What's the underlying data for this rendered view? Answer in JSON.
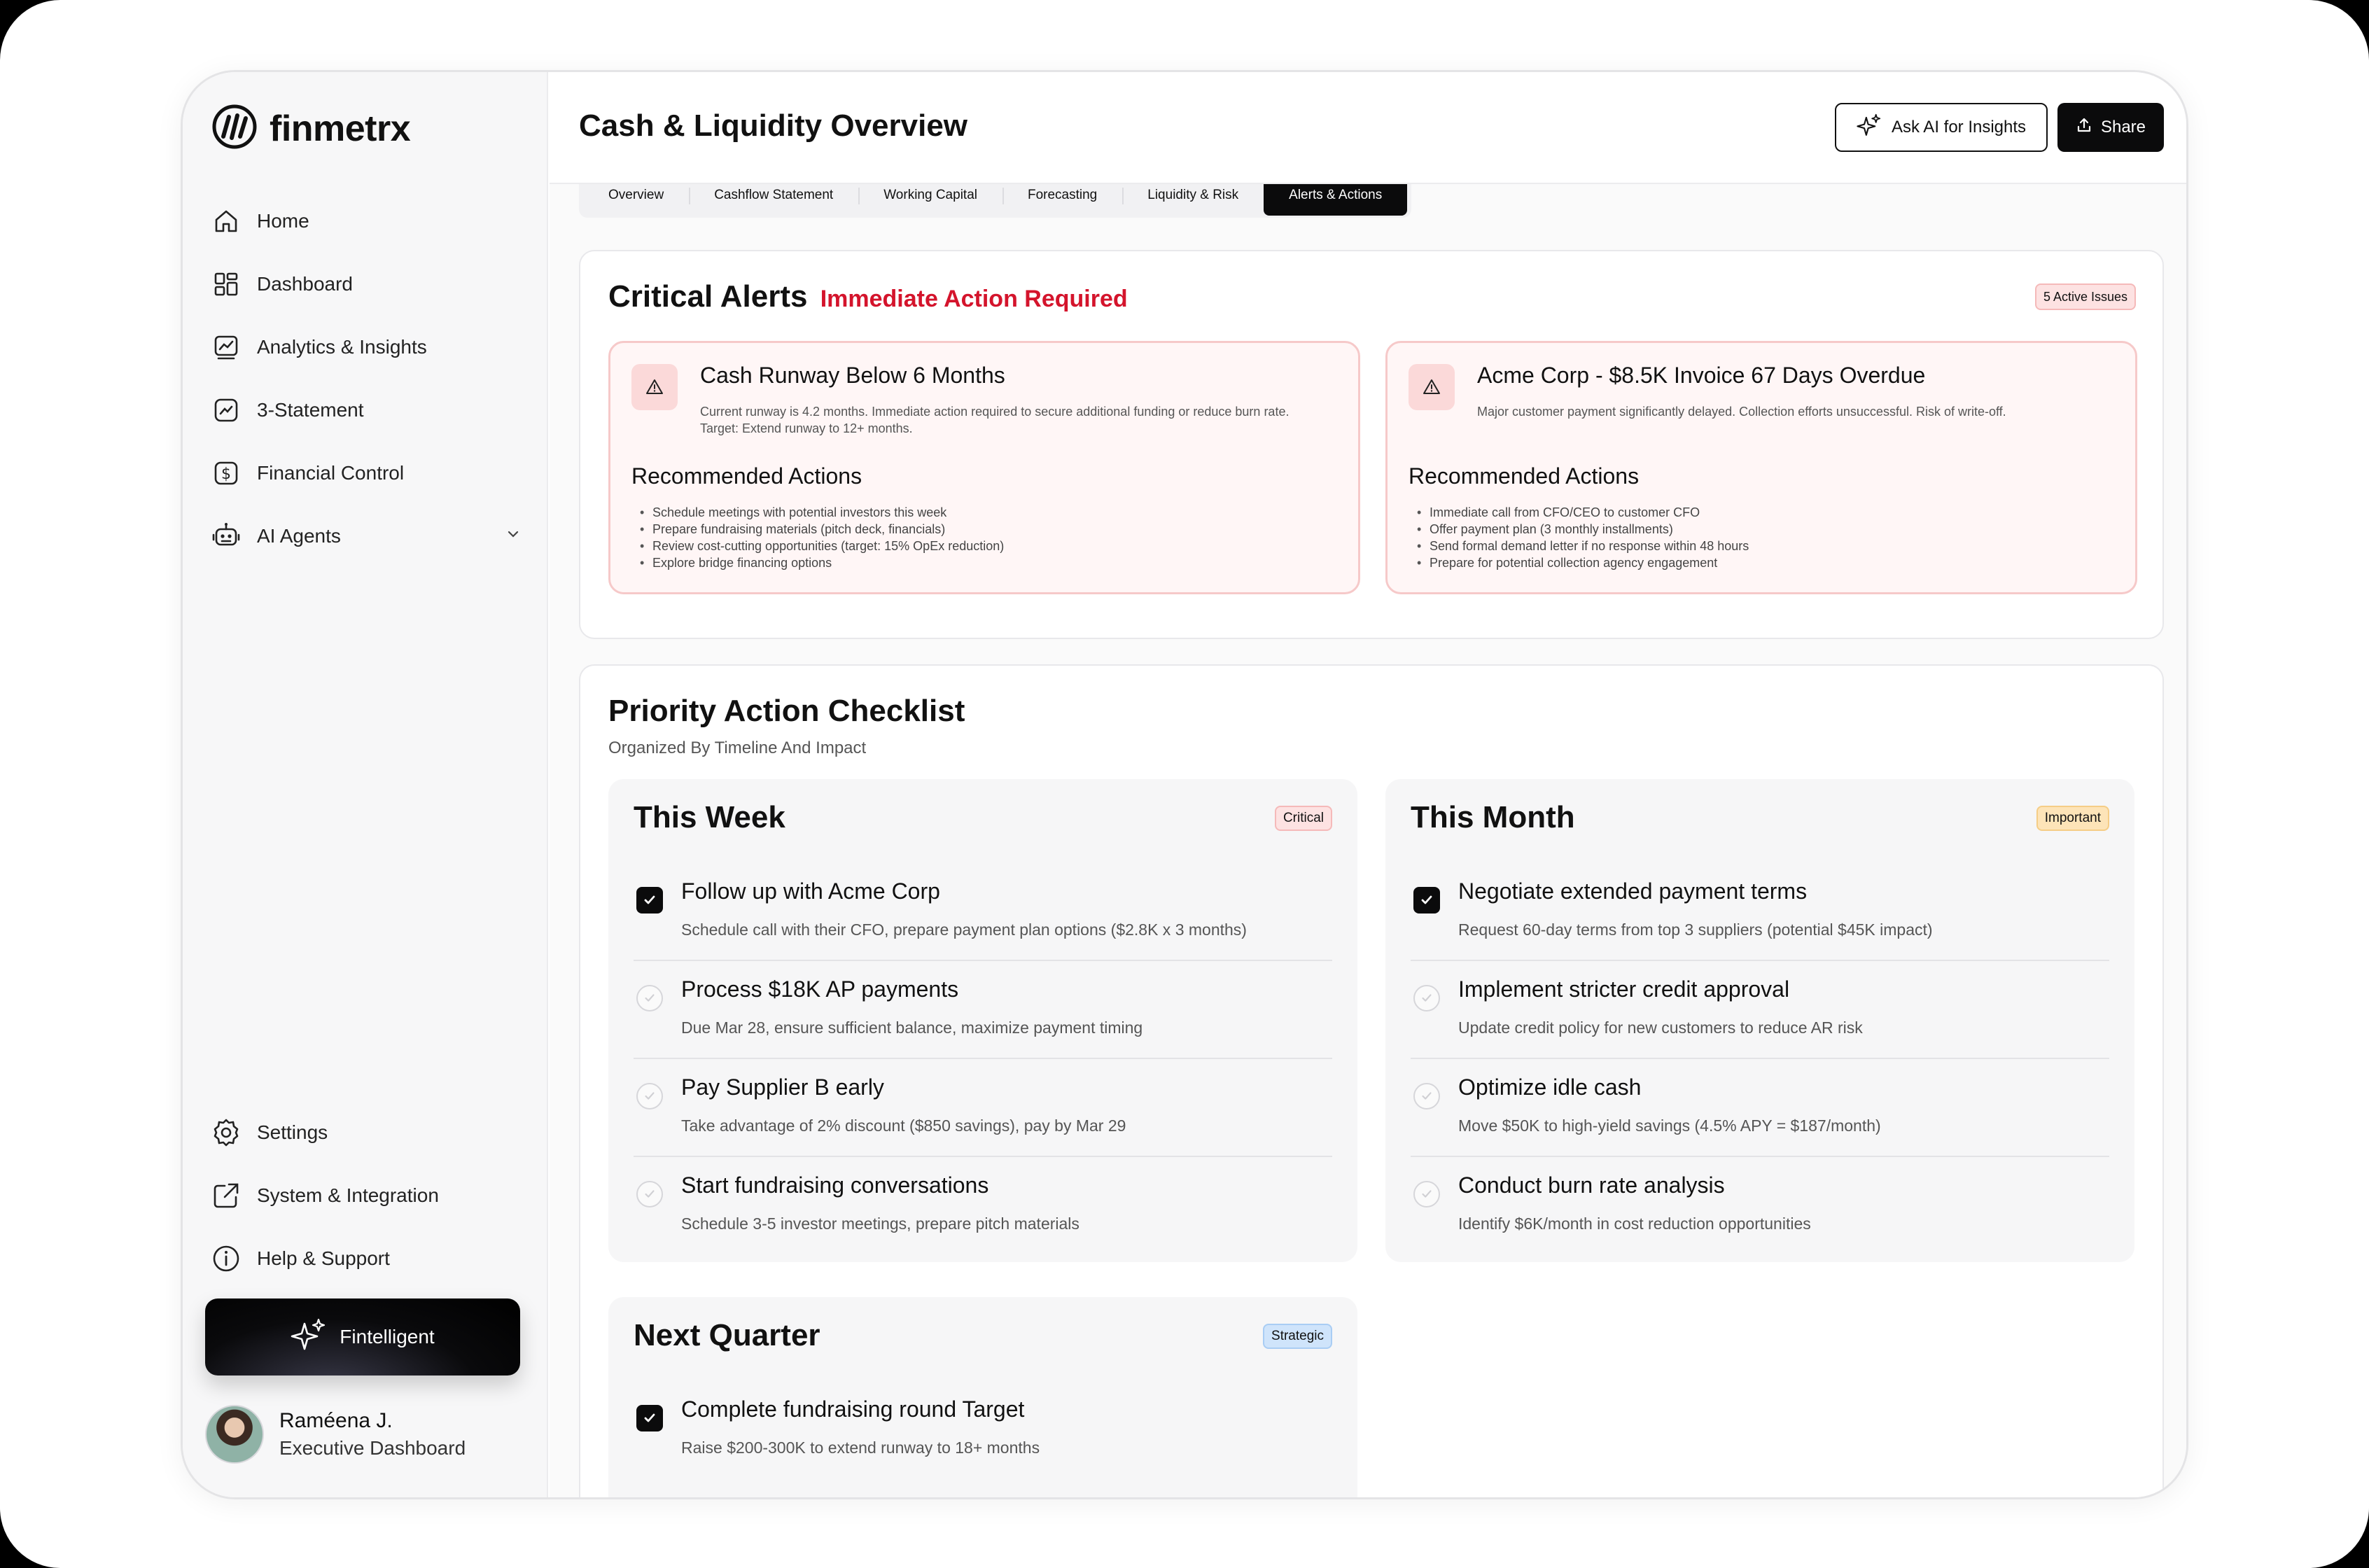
{
  "brand": {
    "name": "finmetrx"
  },
  "sidebar": {
    "items": [
      {
        "label": "Home",
        "icon": "home-icon"
      },
      {
        "label": "Dashboard",
        "icon": "dashboard-icon"
      },
      {
        "label": "Analytics & Insights",
        "icon": "analytics-icon"
      },
      {
        "label": "3-Statement",
        "icon": "trend-icon"
      },
      {
        "label": "Financial Control",
        "icon": "dollar-icon"
      },
      {
        "label": "AI Agents",
        "icon": "robot-icon"
      }
    ],
    "bottom_items": [
      {
        "label": "Settings",
        "icon": "gear-icon"
      },
      {
        "label": "System & Integration",
        "icon": "external-link-icon"
      },
      {
        "label": "Help & Support",
        "icon": "info-icon"
      }
    ],
    "fintelligent_label": "Fintelligent",
    "user": {
      "name": "Raméena J.",
      "role": "Executive Dashboard"
    }
  },
  "header": {
    "title": "Cash & Liquidity Overview",
    "ask_ai_label": "Ask AI for Insights",
    "share_label": "Share"
  },
  "tabs": [
    {
      "label": "Overview",
      "active": false
    },
    {
      "label": "Cashflow Statement",
      "active": false
    },
    {
      "label": "Working Capital",
      "active": false
    },
    {
      "label": "Forecasting",
      "active": false
    },
    {
      "label": "Liquidity & Risk",
      "active": false
    },
    {
      "label": "Alerts & Actions",
      "active": true
    }
  ],
  "alerts": {
    "title": "Critical Alerts",
    "subtitle": "Immediate Action Required",
    "badge": "5 Active Issues",
    "cards": [
      {
        "title": "Cash Runway Below 6 Months",
        "description": "Current runway is 4.2 months. Immediate action required to secure additional funding or reduce burn rate. Target: Extend runway to 12+ months.",
        "actions_title": "Recommended Actions",
        "actions": [
          "Schedule meetings with potential investors this week",
          "Prepare fundraising materials (pitch deck, financials)",
          "Review cost-cutting opportunities (target: 15% OpEx reduction)",
          "Explore bridge financing options"
        ]
      },
      {
        "title": "Acme Corp - $8.5K Invoice 67 Days Overdue",
        "description": "Major customer payment significantly delayed. Collection efforts unsuccessful. Risk of write-off.",
        "actions_title": "Recommended Actions",
        "actions": [
          "Immediate call from CFO/CEO to customer CFO",
          "Offer payment plan (3 monthly installments)",
          "Send formal demand letter if no response within 48 hours",
          "Prepare for potential collection agency engagement"
        ]
      }
    ]
  },
  "checklist": {
    "title": "Priority Action Checklist",
    "subtitle": "Organized By Timeline And Impact",
    "panels": [
      {
        "title": "This Week",
        "tag": "Critical",
        "items": [
          {
            "title": "Follow up with Acme Corp",
            "desc": "Schedule call with their CFO, prepare payment plan options ($2.8K x 3 months)",
            "done": true
          },
          {
            "title": "Process $18K AP payments",
            "desc": "Due Mar 28, ensure sufficient balance, maximize payment timing",
            "done": false
          },
          {
            "title": "Pay Supplier B early",
            "desc": "Take advantage of 2% discount ($850 savings), pay by Mar 29",
            "done": false
          },
          {
            "title": "Start fundraising conversations",
            "desc": "Schedule 3-5 investor meetings, prepare pitch materials",
            "done": false
          }
        ]
      },
      {
        "title": "This Month",
        "tag": "Important",
        "items": [
          {
            "title": "Negotiate extended payment terms",
            "desc": "Request 60-day terms from top 3 suppliers (potential $45K impact)",
            "done": true
          },
          {
            "title": "Implement stricter credit approval",
            "desc": "Update credit policy for new customers to reduce AR risk",
            "done": false
          },
          {
            "title": "Optimize idle cash",
            "desc": "Move $50K to high-yield savings (4.5% APY = $187/month)",
            "done": false
          },
          {
            "title": "Conduct burn rate analysis",
            "desc": "Identify $6K/month in cost reduction opportunities",
            "done": false
          }
        ]
      },
      {
        "title": "Next Quarter",
        "tag": "Strategic",
        "items": [
          {
            "title": "Complete fundraising round Target",
            "desc": "Raise $200-300K to extend runway to 18+ months",
            "done": true
          }
        ]
      }
    ]
  },
  "colors": {
    "accent": "#0b0b0c",
    "alert_red": "#d4142c",
    "alert_bg": "#fff6f6",
    "critical_tag": "#fde2e2",
    "important_tag": "#fde4b8",
    "strategic_tag": "#cfe4fb"
  }
}
